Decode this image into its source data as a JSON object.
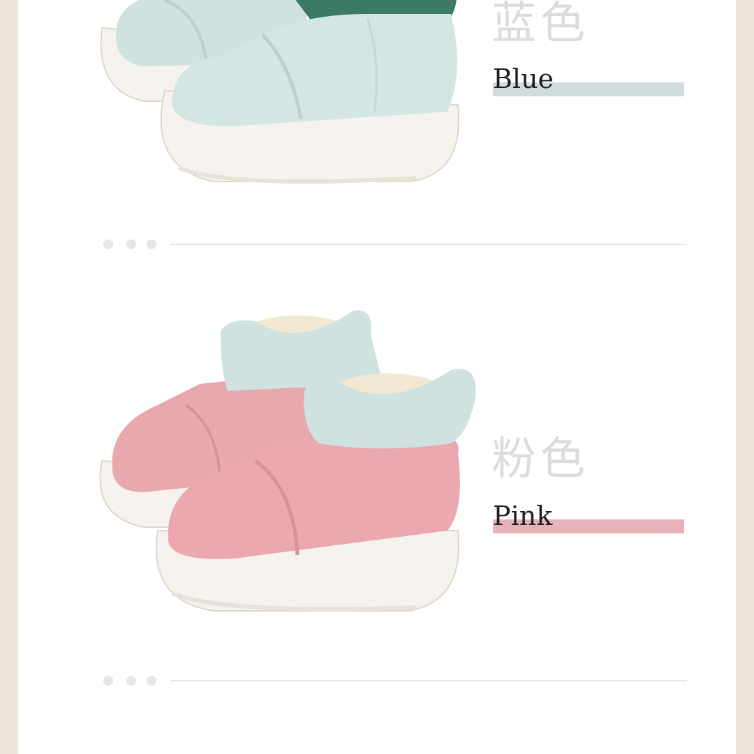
{
  "colors": {
    "background": "#ece4d8",
    "panel": "#ffffff",
    "chinese_label": "#dcdcdc",
    "divider": "#e6e6e6",
    "blue_swatch": "#d0dcdd",
    "pink_swatch": "#e7b2ba",
    "boot_blue": "#cfe2e0",
    "boot_green": "#3d7a66",
    "boot_pink": "#e8a9ae",
    "sole": "#f6f3ee",
    "lining": "#f2e8d2"
  },
  "variants": [
    {
      "zh_label": "蓝色",
      "en_label": "Blue",
      "swatch_color": "#d0dcdd",
      "image_icon": "blue-snow-boot-photo"
    },
    {
      "zh_label": "粉色",
      "en_label": "Pink",
      "swatch_color": "#e7b2ba",
      "image_icon": "pink-snow-boot-photo"
    }
  ]
}
